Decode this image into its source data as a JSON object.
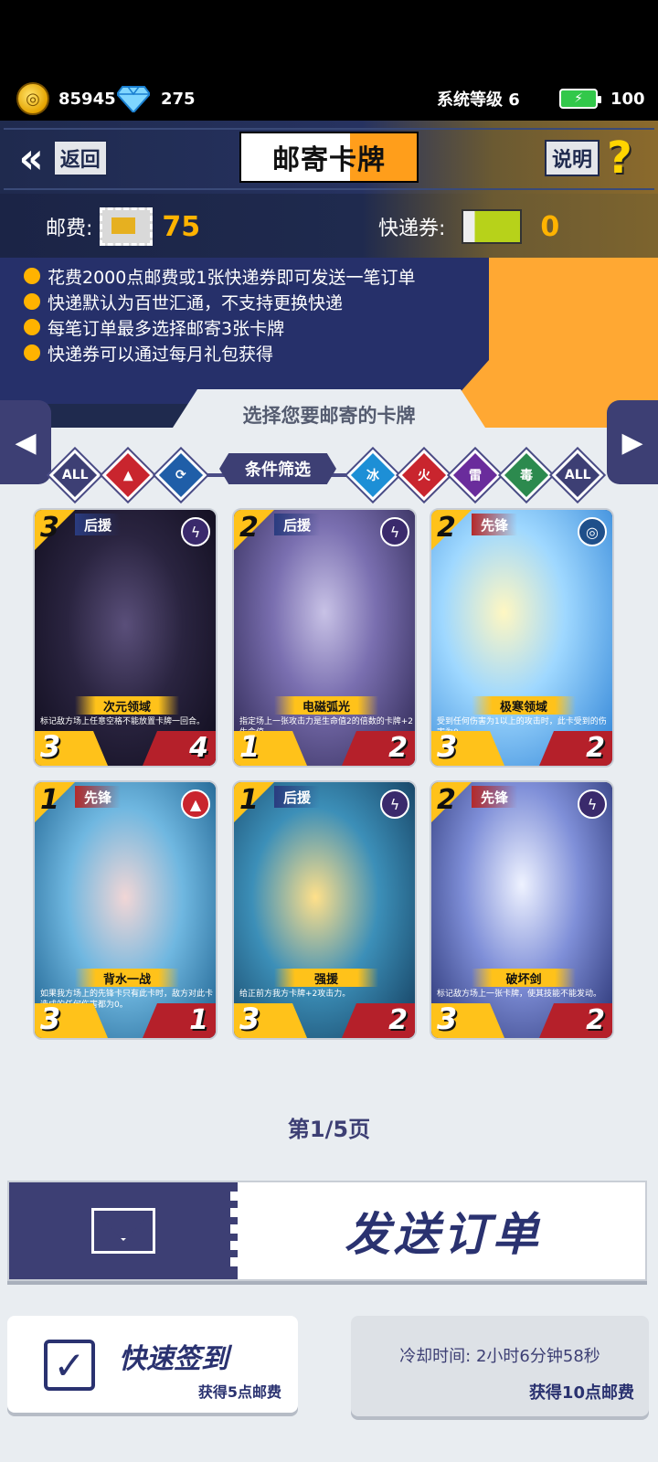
{
  "status": {
    "coins": "85945",
    "gems": "275",
    "system_level": "系统等级 6",
    "energy": "100"
  },
  "header": {
    "back_label": "返回",
    "title": "邮寄卡牌",
    "help_label": "说明",
    "help_icon": "?"
  },
  "fees": {
    "postage_label": "邮费:",
    "postage_value": "75",
    "voucher_label": "快递券:",
    "voucher_value": "0"
  },
  "rules": [
    "花费2000点邮费或1张快递券即可发送一笔订单",
    "快递默认为百世汇通，不支持更换快递",
    "每笔订单最多选择邮寄3张卡牌",
    "快递券可以通过每月礼包获得"
  ],
  "select_title": "选择您要邮寄的卡牌",
  "filters": {
    "label": "条件筛选",
    "left": [
      "ALL",
      "",
      ""
    ],
    "right": [
      "冰",
      "火",
      "雷",
      "毒",
      "ALL"
    ]
  },
  "cards": [
    {
      "cost": "3",
      "role": "后援",
      "name": "次元领域",
      "desc_tag": "",
      "desc": "标记敌方场上任意空格不能放置卡牌一回合。",
      "atk": "3",
      "hp": "4"
    },
    {
      "cost": "2",
      "role": "后援",
      "name": "电磁弧光",
      "desc_tag": "",
      "desc": "指定场上一张攻击力是生命值2的倍数的卡牌+2生命值。",
      "atk": "1",
      "hp": "2"
    },
    {
      "cost": "2",
      "role": "先锋",
      "name": "极寒领域",
      "desc_tag": "",
      "desc": "受到任何伤害为1以上的攻击时，此卡受到的伤害为0。",
      "atk": "3",
      "hp": "2"
    },
    {
      "cost": "1",
      "role": "先锋",
      "name": "背水一战",
      "desc_tag": "",
      "desc": "如果我方场上的先锋卡只有此卡时，敌方对此卡造成的任何伤害都为0。",
      "atk": "3",
      "hp": "1"
    },
    {
      "cost": "1",
      "role": "后援",
      "name": "强援",
      "desc_tag": "",
      "desc": "给正前方我方卡牌+2攻击力。",
      "atk": "3",
      "hp": "2"
    },
    {
      "cost": "2",
      "role": "先锋",
      "name": "破坏剑",
      "desc_tag": "",
      "desc": "标记敌方场上一张卡牌，使其技能不能发动。",
      "atk": "3",
      "hp": "2"
    }
  ],
  "pagination": {
    "text": "第1/5页"
  },
  "actions": {
    "send_label": "发送订单",
    "checkin_title": "快速签到",
    "checkin_reward": "获得5点邮费",
    "cooldown_text": "冷却时间: 2小时6分钟58秒",
    "cooldown_reward": "获得10点邮费"
  }
}
